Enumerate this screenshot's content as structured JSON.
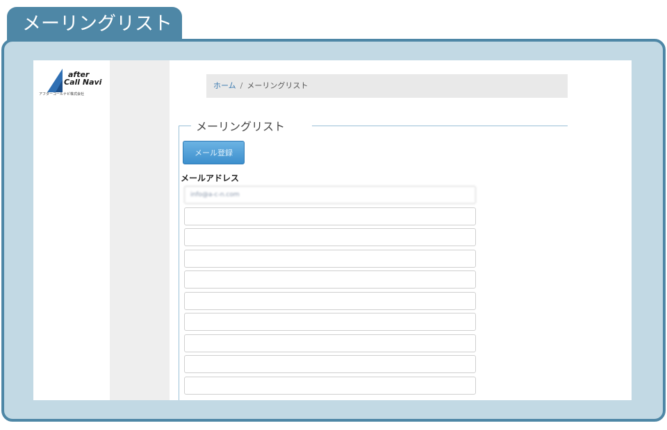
{
  "page_title": "メーリングリスト",
  "logo": {
    "line1": "after",
    "line2": "Call Navi",
    "company": "アフターコールナビ株式会社"
  },
  "breadcrumb": {
    "home": "ホーム",
    "separator": "/",
    "current": "メーリングリスト"
  },
  "section": {
    "legend": "メーリングリスト",
    "register_button": "メール登録",
    "email_label": "メールアドレス",
    "email_fields": [
      "info@a-c-n.com",
      "",
      "",
      "",
      "",
      "",
      "",
      "",
      "",
      ""
    ]
  },
  "colors": {
    "frame": "#4e87a6",
    "frame_bg": "#c2d9e4",
    "accent": "#3d8fcd"
  }
}
